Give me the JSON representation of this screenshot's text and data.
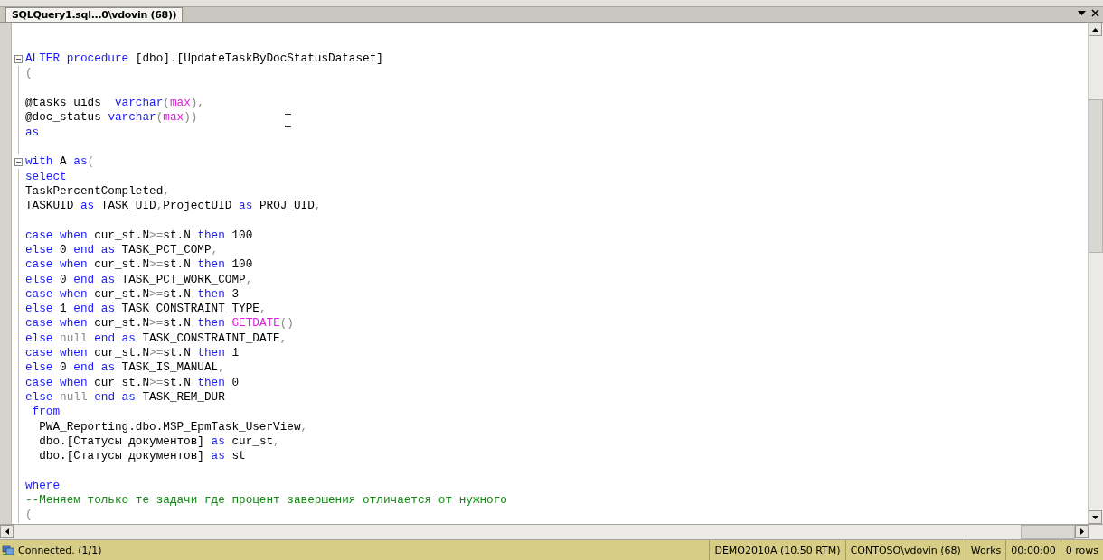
{
  "tab": {
    "title": "SQLQuery1.sql...0\\vdovin (68))",
    "selected": true
  },
  "editor": {
    "lines": [
      {
        "fold": true,
        "tokens": [
          {
            "kind": "kw",
            "text": "ALTER procedure"
          },
          {
            "kind": "plain",
            "text": " [dbo]"
          },
          {
            "kind": "gray",
            "text": "."
          },
          {
            "kind": "plain",
            "text": "[UpdateTaskByDocStatusDataset]"
          }
        ]
      },
      {
        "fold": false,
        "tokens": [
          {
            "kind": "gray",
            "text": "("
          }
        ]
      },
      {
        "fold": false
      },
      {
        "fold": false,
        "tokens": [
          {
            "kind": "plain",
            "text": "@tasks_uids  "
          },
          {
            "kind": "kw",
            "text": "varchar"
          },
          {
            "kind": "gray",
            "text": "("
          },
          {
            "kind": "fn",
            "text": "max"
          },
          {
            "kind": "gray",
            "text": "),"
          }
        ]
      },
      {
        "fold": false,
        "tokens": [
          {
            "kind": "plain",
            "text": "@doc_status "
          },
          {
            "kind": "kw",
            "text": "varchar"
          },
          {
            "kind": "gray",
            "text": "("
          },
          {
            "kind": "fn",
            "text": "max"
          },
          {
            "kind": "gray",
            "text": "))"
          }
        ]
      },
      {
        "fold": false,
        "tokens": [
          {
            "kind": "kw",
            "text": "as"
          }
        ]
      },
      {
        "fold": false
      },
      {
        "fold": true,
        "tokens": [
          {
            "kind": "kw",
            "text": "with"
          },
          {
            "kind": "plain",
            "text": " A "
          },
          {
            "kind": "kw",
            "text": "as"
          },
          {
            "kind": "gray",
            "text": "("
          }
        ]
      },
      {
        "fold": false,
        "tokens": [
          {
            "kind": "kw",
            "text": "select"
          }
        ]
      },
      {
        "fold": false,
        "tokens": [
          {
            "kind": "plain",
            "text": "TaskPercentCompleted"
          },
          {
            "kind": "gray",
            "text": ","
          }
        ]
      },
      {
        "fold": false,
        "tokens": [
          {
            "kind": "plain",
            "text": "TASKUID "
          },
          {
            "kind": "kw",
            "text": "as"
          },
          {
            "kind": "plain",
            "text": " TASK_UID"
          },
          {
            "kind": "gray",
            "text": ","
          },
          {
            "kind": "plain",
            "text": "ProjectUID "
          },
          {
            "kind": "kw",
            "text": "as"
          },
          {
            "kind": "plain",
            "text": " PROJ_UID"
          },
          {
            "kind": "gray",
            "text": ","
          }
        ]
      },
      {
        "fold": false
      },
      {
        "fold": false,
        "tokens": [
          {
            "kind": "kw",
            "text": "case when"
          },
          {
            "kind": "plain",
            "text": " cur_st.N"
          },
          {
            "kind": "gray",
            "text": ">="
          },
          {
            "kind": "plain",
            "text": "st.N "
          },
          {
            "kind": "kw",
            "text": "then"
          },
          {
            "kind": "plain",
            "text": " 100"
          }
        ]
      },
      {
        "fold": false,
        "tokens": [
          {
            "kind": "kw",
            "text": "else"
          },
          {
            "kind": "plain",
            "text": " 0 "
          },
          {
            "kind": "kw",
            "text": "end as"
          },
          {
            "kind": "plain",
            "text": " TASK_PCT_COMP"
          },
          {
            "kind": "gray",
            "text": ","
          }
        ]
      },
      {
        "fold": false,
        "tokens": [
          {
            "kind": "kw",
            "text": "case when"
          },
          {
            "kind": "plain",
            "text": " cur_st.N"
          },
          {
            "kind": "gray",
            "text": ">="
          },
          {
            "kind": "plain",
            "text": "st.N "
          },
          {
            "kind": "kw",
            "text": "then"
          },
          {
            "kind": "plain",
            "text": " 100"
          }
        ]
      },
      {
        "fold": false,
        "tokens": [
          {
            "kind": "kw",
            "text": "else"
          },
          {
            "kind": "plain",
            "text": " 0 "
          },
          {
            "kind": "kw",
            "text": "end as"
          },
          {
            "kind": "plain",
            "text": " TASK_PCT_WORK_COMP"
          },
          {
            "kind": "gray",
            "text": ","
          }
        ]
      },
      {
        "fold": false,
        "tokens": [
          {
            "kind": "kw",
            "text": "case when"
          },
          {
            "kind": "plain",
            "text": " cur_st.N"
          },
          {
            "kind": "gray",
            "text": ">="
          },
          {
            "kind": "plain",
            "text": "st.N "
          },
          {
            "kind": "kw",
            "text": "then"
          },
          {
            "kind": "plain",
            "text": " 3"
          }
        ]
      },
      {
        "fold": false,
        "tokens": [
          {
            "kind": "kw",
            "text": "else"
          },
          {
            "kind": "plain",
            "text": " 1 "
          },
          {
            "kind": "kw",
            "text": "end as"
          },
          {
            "kind": "plain",
            "text": " TASK_CONSTRAINT_TYPE"
          },
          {
            "kind": "gray",
            "text": ","
          }
        ]
      },
      {
        "fold": false,
        "tokens": [
          {
            "kind": "kw",
            "text": "case when"
          },
          {
            "kind": "plain",
            "text": " cur_st.N"
          },
          {
            "kind": "gray",
            "text": ">="
          },
          {
            "kind": "plain",
            "text": "st.N "
          },
          {
            "kind": "kw",
            "text": "then "
          },
          {
            "kind": "fn",
            "text": "GETDATE"
          },
          {
            "kind": "gray",
            "text": "()"
          }
        ]
      },
      {
        "fold": false,
        "tokens": [
          {
            "kind": "kw",
            "text": "else "
          },
          {
            "kind": "gray",
            "text": "null "
          },
          {
            "kind": "kw",
            "text": "end as"
          },
          {
            "kind": "plain",
            "text": " TASK_CONSTRAINT_DATE"
          },
          {
            "kind": "gray",
            "text": ","
          }
        ]
      },
      {
        "fold": false,
        "tokens": [
          {
            "kind": "kw",
            "text": "case when"
          },
          {
            "kind": "plain",
            "text": " cur_st.N"
          },
          {
            "kind": "gray",
            "text": ">="
          },
          {
            "kind": "plain",
            "text": "st.N "
          },
          {
            "kind": "kw",
            "text": "then"
          },
          {
            "kind": "plain",
            "text": " 1"
          }
        ]
      },
      {
        "fold": false,
        "tokens": [
          {
            "kind": "kw",
            "text": "else"
          },
          {
            "kind": "plain",
            "text": " 0 "
          },
          {
            "kind": "kw",
            "text": "end as"
          },
          {
            "kind": "plain",
            "text": " TASK_IS_MANUAL"
          },
          {
            "kind": "gray",
            "text": ","
          }
        ]
      },
      {
        "fold": false,
        "tokens": [
          {
            "kind": "kw",
            "text": "case when"
          },
          {
            "kind": "plain",
            "text": " cur_st.N"
          },
          {
            "kind": "gray",
            "text": ">="
          },
          {
            "kind": "plain",
            "text": "st.N "
          },
          {
            "kind": "kw",
            "text": "then"
          },
          {
            "kind": "plain",
            "text": " 0"
          }
        ]
      },
      {
        "fold": false,
        "tokens": [
          {
            "kind": "kw",
            "text": "else "
          },
          {
            "kind": "gray",
            "text": "null "
          },
          {
            "kind": "kw",
            "text": "end as"
          },
          {
            "kind": "plain",
            "text": " TASK_REM_DUR"
          }
        ]
      },
      {
        "fold": false,
        "tokens": [
          {
            "kind": "kw",
            "text": " from"
          }
        ]
      },
      {
        "fold": false,
        "tokens": [
          {
            "kind": "plain",
            "text": "  PWA_Reporting.dbo.MSP_EpmTask_UserView"
          },
          {
            "kind": "gray",
            "text": ","
          }
        ]
      },
      {
        "fold": false,
        "tokens": [
          {
            "kind": "plain",
            "text": "  dbo.[Статусы документов] "
          },
          {
            "kind": "kw",
            "text": "as"
          },
          {
            "kind": "plain",
            "text": " cur_st"
          },
          {
            "kind": "gray",
            "text": ","
          }
        ]
      },
      {
        "fold": false,
        "tokens": [
          {
            "kind": "plain",
            "text": "  dbo.[Статусы документов] "
          },
          {
            "kind": "kw",
            "text": "as"
          },
          {
            "kind": "plain",
            "text": " st"
          }
        ]
      },
      {
        "fold": false
      },
      {
        "fold": false,
        "tokens": [
          {
            "kind": "kw",
            "text": "where"
          }
        ]
      },
      {
        "fold": false,
        "tokens": [
          {
            "kind": "comment",
            "text": "--Меняем только те задачи где процент завершения отличается от нужного"
          }
        ]
      },
      {
        "fold": false,
        "tokens": [
          {
            "kind": "gray",
            "text": "("
          }
        ]
      }
    ]
  },
  "status_bar": {
    "message": "Connected. (1/1)",
    "panels": [
      "DEMO2010A (10.50 RTM)",
      "CONTOSO\\vdovin (68)",
      "Works",
      "00:00:00",
      "0 rows"
    ]
  }
}
